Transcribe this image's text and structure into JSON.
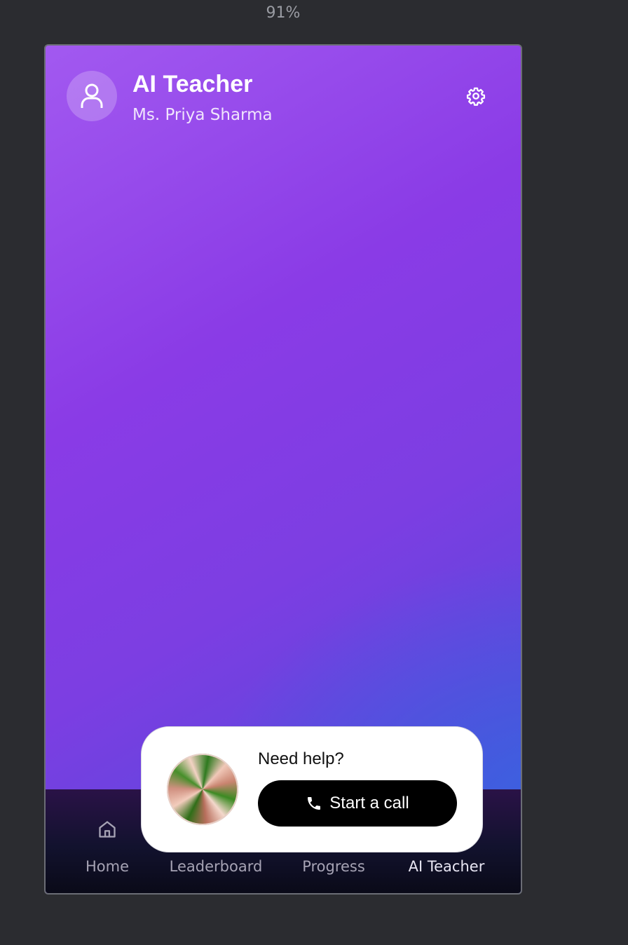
{
  "zoom": "91%",
  "header": {
    "title": "AI Teacher",
    "subtitle": "Ms. Priya Sharma",
    "avatar_icon": "user-icon",
    "settings_icon": "gear-icon"
  },
  "nav": {
    "items": [
      {
        "label": "Home",
        "icon": "home-icon"
      },
      {
        "label": "Leaderboard"
      },
      {
        "label": "Progress"
      },
      {
        "label": "AI Teacher",
        "active": true
      }
    ]
  },
  "help_card": {
    "prompt": "Need help?",
    "call_label": "Start a call",
    "call_icon": "phone-icon"
  },
  "colors": {
    "gradient_start": "#a259f0",
    "gradient_mid": "#8a3be6",
    "gradient_end": "#3e55d6",
    "call_button": "#000000"
  }
}
